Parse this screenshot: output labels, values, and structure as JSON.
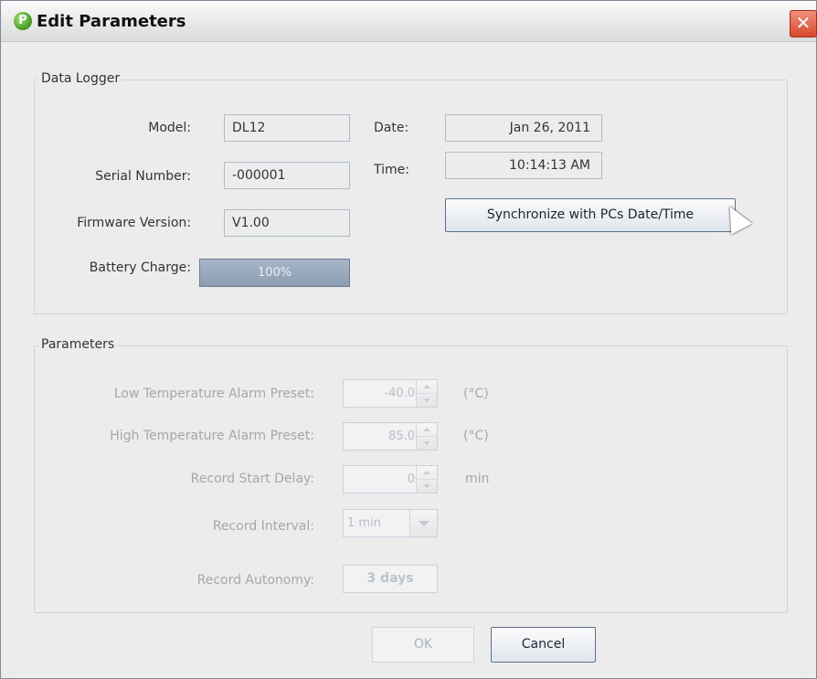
{
  "window": {
    "title": "Edit Parameters",
    "icon_glyph": "P"
  },
  "data_logger": {
    "group_title": "Data Logger",
    "model_label": "Model:",
    "model_value": "DL12",
    "serial_label": "Serial Number:",
    "serial_value": "-000001",
    "firmware_label": "Firmware Version:",
    "firmware_value": "V1.00",
    "battery_label": "Battery Charge:",
    "battery_value": "100%",
    "date_label": "Date:",
    "date_value": "Jan 26, 2011",
    "time_label": "Time:",
    "time_value": "10:14:13 AM",
    "sync_button_label": "Synchronize with PCs Date/Time"
  },
  "parameters": {
    "group_title": "Parameters",
    "low_temp_label": "Low Temperature Alarm Preset:",
    "low_temp_value": "-40.0",
    "low_temp_unit": "(°C)",
    "high_temp_label": "High Temperature Alarm Preset:",
    "high_temp_value": "85.0",
    "high_temp_unit": "(°C)",
    "start_delay_label": "Record Start Delay:",
    "start_delay_value": "0",
    "start_delay_unit": "min",
    "interval_label": "Record Interval:",
    "interval_value": "1 min",
    "autonomy_label": "Record Autonomy:",
    "autonomy_value": "3 days"
  },
  "buttons": {
    "ok": "OK",
    "cancel": "Cancel"
  },
  "close_glyph": "✕",
  "colors": {
    "battery_fill": "#8c9db1",
    "disabled_text": "#a7a7a7",
    "close_button": "#d8482b"
  }
}
